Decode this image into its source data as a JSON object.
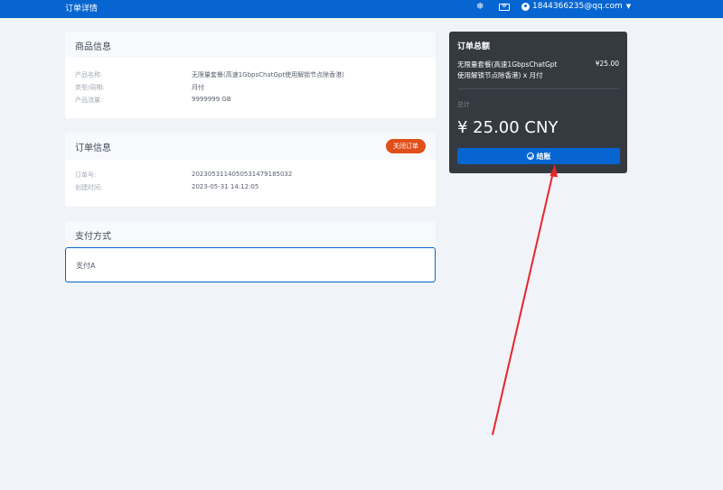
{
  "header": {
    "title": "订单详情",
    "user_email": "1844366235@qq.com"
  },
  "goods": {
    "heading": "商品信息",
    "rows": [
      {
        "label": "产品名称:",
        "value": "无限量套餐(高速1GbpsChatGpt使用解锁节点除香港)"
      },
      {
        "label": "类型/周期:",
        "value": "月付"
      },
      {
        "label": "产品流量:",
        "value": "9999999 GB"
      }
    ]
  },
  "order": {
    "heading": "订单信息",
    "close_label": "关闭订单",
    "rows": [
      {
        "label": "订单号:",
        "value": "2023053114050531479185032"
      },
      {
        "label": "创建时间:",
        "value": "2023-05-31 14:12:05"
      }
    ]
  },
  "payment": {
    "heading": "支付方式",
    "option": "支付A"
  },
  "summary": {
    "title": "订单总额",
    "item_line1": "无限量套餐(高速1GbpsChatGpt",
    "item_line2": "使用解锁节点除香港) x 月付",
    "item_price": "¥25.00",
    "total_label": "总计",
    "total": "¥ 25.00 CNY",
    "checkout_label": "结账"
  },
  "colors": {
    "accent": "#0665d0",
    "danger": "#e04f1a",
    "annotation": "#e8252c"
  }
}
